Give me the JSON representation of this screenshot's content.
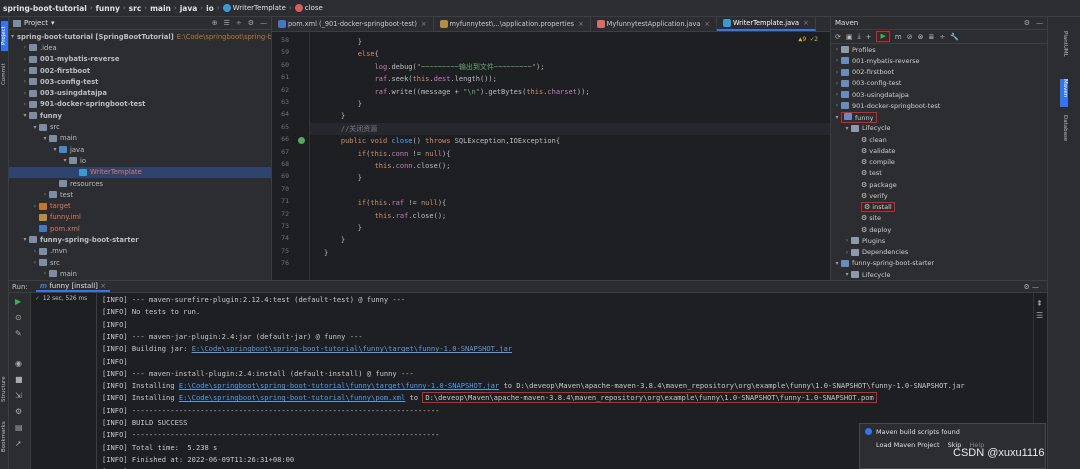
{
  "breadcrumb": {
    "items": [
      "spring-boot-tutorial",
      "funny",
      "src",
      "main",
      "java",
      "io"
    ],
    "class": "WriterTemplate",
    "method": "close"
  },
  "project": {
    "title": "Project",
    "rows": [
      {
        "t": "spring-boot-tutorial [SpringBootTutorial]",
        "extra": "E:\\Code\\springboot\\spring-b",
        "d": 0,
        "a": "v",
        "c": "#7d8ea3",
        "b": true
      },
      {
        "t": ".idea",
        "d": 1,
        "a": ">",
        "c": "#7d8ea3"
      },
      {
        "t": "001-mybatis-reverse",
        "d": 1,
        "a": ">",
        "c": "#7d8ea3",
        "b": true
      },
      {
        "t": "002-firstboot",
        "d": 1,
        "a": ">",
        "c": "#7d8ea3",
        "b": true
      },
      {
        "t": "003-config-test",
        "d": 1,
        "a": ">",
        "c": "#7d8ea3",
        "b": true
      },
      {
        "t": "003-usingdatajpa",
        "d": 1,
        "a": ">",
        "c": "#7d8ea3",
        "b": true
      },
      {
        "t": "901-docker-springboot-test",
        "d": 1,
        "a": ">",
        "c": "#7d8ea3",
        "b": true
      },
      {
        "t": "funny",
        "d": 1,
        "a": "v",
        "c": "#7d8ea3",
        "b": true
      },
      {
        "t": "src",
        "d": 2,
        "a": "v",
        "c": "#7d8ea3"
      },
      {
        "t": "main",
        "d": 3,
        "a": "v",
        "c": "#7d8ea3"
      },
      {
        "t": "java",
        "d": 4,
        "a": "v",
        "c": "#4a88c7"
      },
      {
        "t": "io",
        "d": 5,
        "a": "v",
        "c": "#7d8ea3"
      },
      {
        "t": "WriterTemplate",
        "d": 6,
        "a": "",
        "c": "#3d9ad1",
        "sel": true,
        "col": "#e07a5f"
      },
      {
        "t": "resources",
        "d": 4,
        "a": "",
        "c": "#7d8ea3"
      },
      {
        "t": "test",
        "d": 3,
        "a": ">",
        "c": "#7d8ea3"
      },
      {
        "t": "target",
        "d": 2,
        "a": ">",
        "c": "#c2762f",
        "col": "#e07a5f"
      },
      {
        "t": "funny.iml",
        "d": 2,
        "a": "",
        "c": "#b58d45",
        "col": "#e07a5f"
      },
      {
        "t": "pom.xml",
        "d": 2,
        "a": "",
        "c": "#4a78c0",
        "col": "#e07a5f"
      },
      {
        "t": "funny-spring-boot-starter",
        "d": 1,
        "a": "v",
        "c": "#7d8ea3",
        "b": true
      },
      {
        "t": ".mvn",
        "d": 2,
        "a": ">",
        "c": "#7d8ea3"
      },
      {
        "t": "src",
        "d": 2,
        "a": ">",
        "c": "#7d8ea3"
      },
      {
        "t": "main",
        "d": 3,
        "a": ">",
        "c": "#7d8ea3"
      }
    ]
  },
  "editor": {
    "tabs": [
      {
        "label": "pom.xml (_901-docker-springboot-test)",
        "c": "#4a78c0"
      },
      {
        "label": "myfunnytest\\...\\application.properties",
        "c": "#b58d45"
      },
      {
        "label": "MyfunnytestApplication.java",
        "c": "#d86b6b"
      },
      {
        "label": "WriterTemplate.java",
        "c": "#3d9ad1",
        "act": true
      }
    ],
    "warn": "▲9 ✓2",
    "lines": [
      {
        "n": "58",
        "h": "<span class='ty'>        }</span>"
      },
      {
        "n": "59",
        "h": "<span class='kw'>        else</span>{"
      },
      {
        "n": "60",
        "h": "            <span class='fld'>log</span>.debug(<span class='str'>\"~~~~~~~~~输出到文件~~~~~~~~~\"</span>);"
      },
      {
        "n": "61",
        "h": "            <span class='fld'>raf</span>.seek(<span class='kw'>this</span>.<span class='fld'>dest</span>.length());"
      },
      {
        "n": "62",
        "h": "            <span class='fld'>raf</span>.write((message + <span class='str'>\"\\n\"</span>).getBytes(<span class='kw'>this</span>.<span class='fld'>charset</span>));"
      },
      {
        "n": "63",
        "h": "        }"
      },
      {
        "n": "64",
        "h": "    }"
      },
      {
        "n": "65",
        "h": "    <span class='cm'>//关闭资源</span>",
        "hl": true
      },
      {
        "n": "66",
        "h": "    <span class='kw'>public void</span> <span class='fn'>close</span>() <span class='kw'>throws</span> SQLException,IOException{"
      },
      {
        "n": "67",
        "h": "        <span class='kw'>if</span>(<span class='kw'>this</span>.<span class='fld'>conn</span> != <span class='kw'>null</span>){"
      },
      {
        "n": "68",
        "h": "            <span class='kw'>this</span>.<span class='fld'>conn</span>.close();"
      },
      {
        "n": "69",
        "h": "        }"
      },
      {
        "n": "70",
        "h": ""
      },
      {
        "n": "71",
        "h": "        <span class='kw'>if</span>(<span class='kw'>this</span>.<span class='fld'>raf</span> != <span class='kw'>null</span>){"
      },
      {
        "n": "72",
        "h": "            <span class='kw'>this</span>.<span class='fld'>raf</span>.close();"
      },
      {
        "n": "73",
        "h": "        }"
      },
      {
        "n": "74",
        "h": "    }"
      },
      {
        "n": "75",
        "h": "}"
      },
      {
        "n": "76",
        "h": ""
      }
    ]
  },
  "maven": {
    "title": "Maven",
    "rows": [
      {
        "t": "Profiles",
        "d": 0,
        "a": ">",
        "ic": "folder"
      },
      {
        "t": "001-mybatis-reverse",
        "d": 0,
        "a": ">",
        "ic": "m"
      },
      {
        "t": "002-firstboot",
        "d": 0,
        "a": ">",
        "ic": "m"
      },
      {
        "t": "003-config-test",
        "d": 0,
        "a": ">",
        "ic": "m"
      },
      {
        "t": "003-usingdatajpa",
        "d": 0,
        "a": ">",
        "ic": "m"
      },
      {
        "t": "901-docker-springboot-test",
        "d": 0,
        "a": ">",
        "ic": "m"
      },
      {
        "t": "funny",
        "d": 0,
        "a": "v",
        "ic": "m",
        "box": true
      },
      {
        "t": "Lifecycle",
        "d": 1,
        "a": "v",
        "ic": "folder"
      },
      {
        "t": "clean",
        "d": 2,
        "ic": "gear"
      },
      {
        "t": "validate",
        "d": 2,
        "ic": "gear"
      },
      {
        "t": "compile",
        "d": 2,
        "ic": "gear"
      },
      {
        "t": "test",
        "d": 2,
        "ic": "gear"
      },
      {
        "t": "package",
        "d": 2,
        "ic": "gear"
      },
      {
        "t": "verify",
        "d": 2,
        "ic": "gear"
      },
      {
        "t": "install",
        "d": 2,
        "ic": "gear",
        "box": true
      },
      {
        "t": "site",
        "d": 2,
        "ic": "gear"
      },
      {
        "t": "deploy",
        "d": 2,
        "ic": "gear"
      },
      {
        "t": "Plugins",
        "d": 1,
        "a": ">",
        "ic": "folder"
      },
      {
        "t": "Dependencies",
        "d": 1,
        "a": ">",
        "ic": "folder"
      },
      {
        "t": "funny-spring-boot-starter",
        "d": 0,
        "a": "v",
        "ic": "m"
      },
      {
        "t": "Lifecycle",
        "d": 1,
        "a": "v",
        "ic": "folder"
      }
    ]
  },
  "run": {
    "label": "Run:",
    "tab": "funny [install]",
    "tree": "funny [install]:",
    "time": "12 sec, 526 ms"
  },
  "console": [
    "[INFO] --- maven-surefire-plugin:2.12.4:test (default-test) @ funny ---",
    "[INFO] No tests to run.",
    "[INFO]",
    "[INFO] --- maven-jar-plugin:2.4:jar (default-jar) @ funny ---",
    {
      "p": "[INFO] Building jar: ",
      "l": "E:\\Code\\springboot\\spring-boot-tutorial\\funny\\target\\funny-1.0-SNAPSHOT.jar"
    },
    "[INFO]",
    "[INFO] --- maven-install-plugin:2.4:install (default-install) @ funny ---",
    {
      "p": "[INFO] Installing ",
      "l": "E:\\Code\\springboot\\spring-boot-tutorial\\funny\\target\\funny-1.0-SNAPSHOT.jar",
      "s": " to D:\\deveop\\Maven\\apache-maven-3.8.4\\maven_repository\\org\\example\\funny\\1.0-SNAPSHOT\\funny-1.0-SNAPSHOT.jar"
    },
    {
      "p": "[INFO] Installing ",
      "l": "E:\\Code\\springboot\\spring-boot-tutorial\\funny\\pom.xml",
      "s": " to ",
      "box": "D:\\deveop\\Maven\\apache-maven-3.8.4\\maven_repository\\org\\example\\funny\\1.0-SNAPSHOT\\funny-1.0-SNAPSHOT.pom"
    },
    "[INFO] ------------------------------------------------------------------------",
    "[INFO] BUILD SUCCESS",
    "[INFO] ------------------------------------------------------------------------",
    "[INFO] Total time:  5.238 s",
    "[INFO] Finished at: 2022-06-09T11:26:31+08:00",
    "[INFO] ------------------------------------------------------------------------"
  ],
  "notification": {
    "title": "Maven build scripts found",
    "actions": [
      "Load Maven Project",
      "Skip",
      "Help"
    ]
  },
  "watermark": "CSDN @xuxu1116",
  "sidebars": {
    "left": [
      "Project",
      "Commit",
      "Structure",
      "Bookmarks"
    ],
    "right": [
      "PlantUML",
      "Maven",
      "Database"
    ]
  }
}
